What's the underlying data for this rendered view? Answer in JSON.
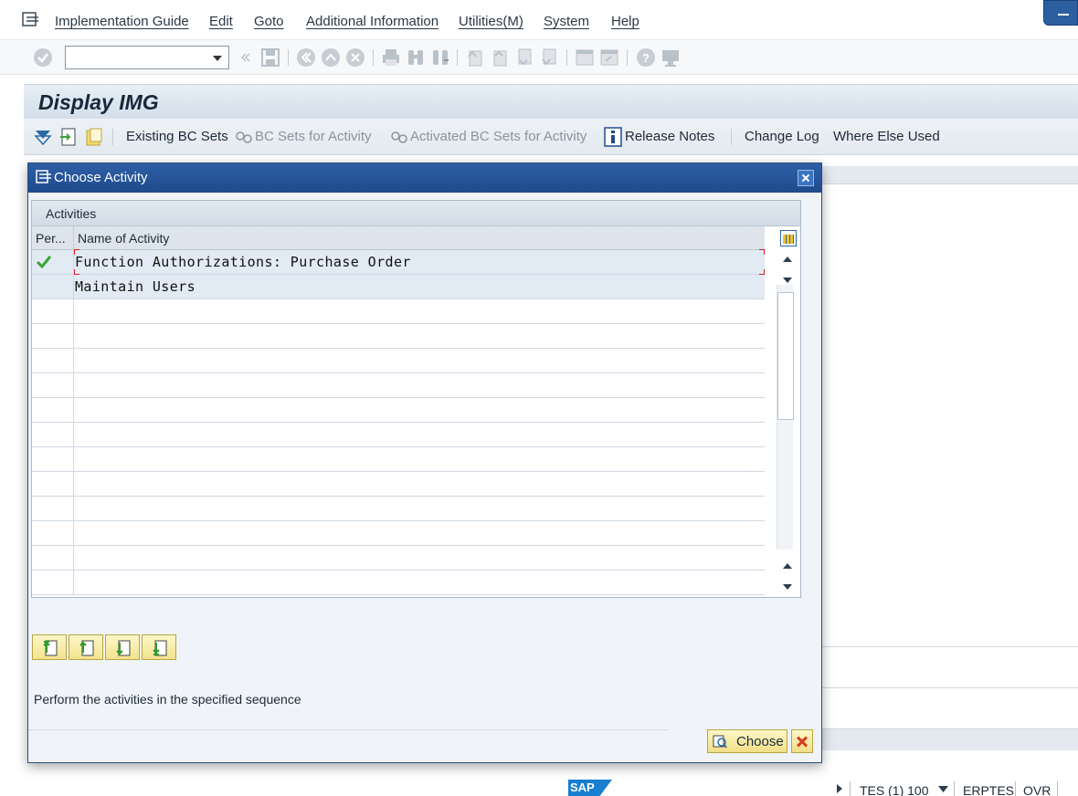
{
  "menu": {
    "items": [
      "Implementation Guide",
      "Edit",
      "Goto",
      "Additional Information",
      "Utilities(M)",
      "System",
      "Help"
    ]
  },
  "toolbar": {
    "command_field_value": "",
    "icons": [
      "enter-icon",
      "back-icon",
      "save-icon",
      "back-nav-icon",
      "exit-icon",
      "cancel-icon",
      "print-icon",
      "find-icon",
      "find-next-icon",
      "first-page-icon",
      "prev-page-icon",
      "next-page-icon",
      "last-page-icon",
      "new-session-icon",
      "shortcut-icon",
      "help-icon",
      "layout-icon"
    ]
  },
  "title": "Display IMG",
  "app_toolbar": {
    "existing_bc_sets": "Existing BC Sets",
    "bc_sets_for_activity": "BC Sets for Activity",
    "activated_bc_sets": "Activated BC Sets for Activity",
    "release_notes": "Release Notes",
    "change_log": "Change Log",
    "where_else_used": "Where Else Used"
  },
  "dialog": {
    "title": "Choose Activity",
    "table_title": "Activities",
    "columns": [
      "Per...",
      "Name of Activity"
    ],
    "rows": [
      {
        "performed": true,
        "name": "Function Authorizations: Purchase Order"
      },
      {
        "performed": false,
        "name": "Maintain Users"
      },
      {
        "performed": false,
        "name": ""
      },
      {
        "performed": false,
        "name": ""
      },
      {
        "performed": false,
        "name": ""
      },
      {
        "performed": false,
        "name": ""
      },
      {
        "performed": false,
        "name": ""
      },
      {
        "performed": false,
        "name": ""
      },
      {
        "performed": false,
        "name": ""
      },
      {
        "performed": false,
        "name": ""
      },
      {
        "performed": false,
        "name": ""
      },
      {
        "performed": false,
        "name": ""
      },
      {
        "performed": false,
        "name": ""
      },
      {
        "performed": false,
        "name": ""
      }
    ],
    "hint": "Perform the activities in the specified sequence",
    "choose_label": "Choose"
  },
  "status_bar": {
    "logo": "SAP",
    "system": "TES (1) 100",
    "server": "ERPTES",
    "mode": "OVR"
  },
  "colors": {
    "dialog_header": "#1f4a8c",
    "check_green": "#3ca33c",
    "selection_red": "#d62020"
  }
}
